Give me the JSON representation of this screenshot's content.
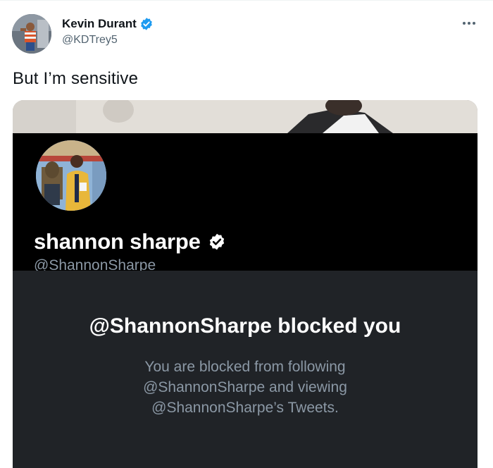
{
  "tweet": {
    "author": {
      "name": "Kevin Durant",
      "handle": "@KDTrey5",
      "verified": true
    },
    "text": "But I’m sensitive",
    "more_icon": "more-horizontal-icon"
  },
  "embedded_profile": {
    "name": "shannon sharpe",
    "handle": "@ShannonSharpe",
    "verified": true,
    "blocked_title": "@ShannonSharpe blocked you",
    "blocked_lines": [
      "You are blocked from following",
      "@ShannonSharpe and viewing",
      "@ShannonSharpe’s Tweets."
    ]
  },
  "colors": {
    "verified_blue": "#1d9bf0",
    "profile_header_bg": "#000000",
    "blocked_panel_bg": "#202327",
    "muted_text": "#8b98a5"
  }
}
